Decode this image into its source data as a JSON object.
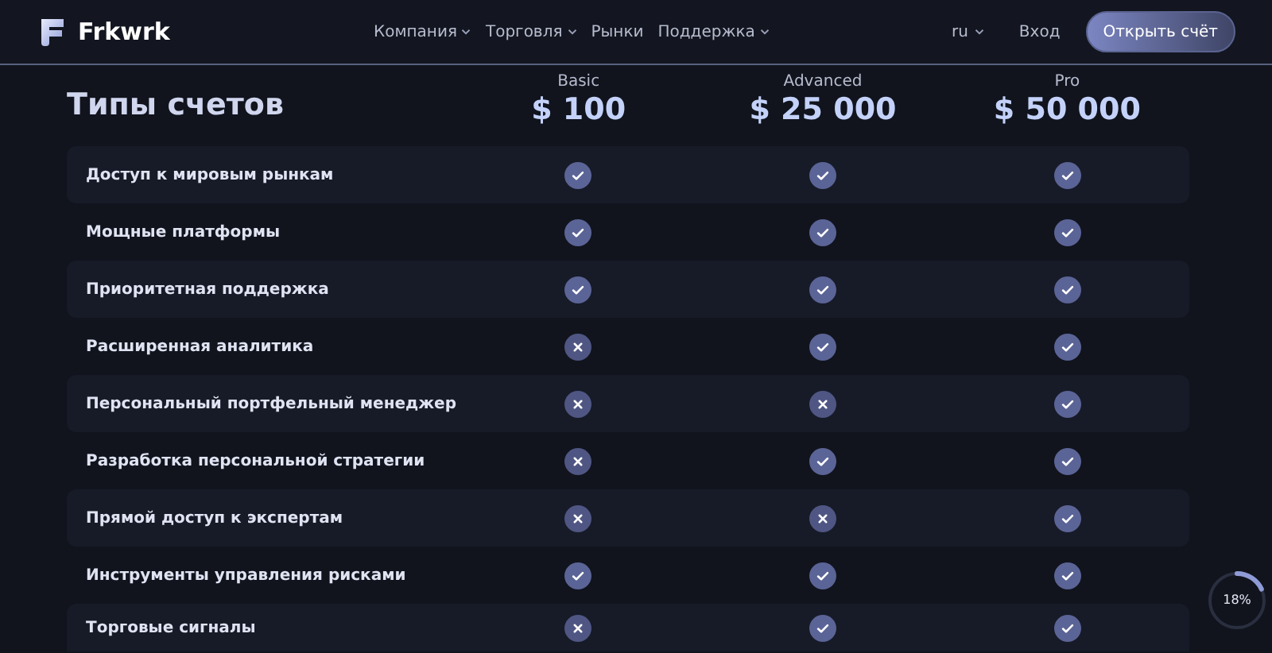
{
  "header": {
    "logo": "Frkwrk",
    "nav": [
      {
        "label": "Компания",
        "dropdown": true
      },
      {
        "label": "Торговля",
        "dropdown": true
      },
      {
        "label": "Рынки",
        "dropdown": false
      },
      {
        "label": "Поддержка",
        "dropdown": true
      }
    ],
    "language": "ru",
    "login": "Вход",
    "cta": "Открыть счёт"
  },
  "title": "Типы счетов",
  "plans": [
    {
      "name": "Basic",
      "price": "$ 100"
    },
    {
      "name": "Advanced",
      "price": "$ 25 000"
    },
    {
      "name": "Pro",
      "price": "$ 50 000"
    }
  ],
  "features": [
    {
      "label": "Доступ к мировым рынкам",
      "included": [
        true,
        true,
        true
      ]
    },
    {
      "label": "Мощные платформы",
      "included": [
        true,
        true,
        true
      ]
    },
    {
      "label": "Приоритетная поддержка",
      "included": [
        true,
        true,
        true
      ]
    },
    {
      "label": "Расширенная аналитика",
      "included": [
        false,
        true,
        true
      ]
    },
    {
      "label": "Персональный портфельный менеджер",
      "included": [
        false,
        false,
        true
      ]
    },
    {
      "label": "Разработка персональной стратегии",
      "included": [
        false,
        true,
        true
      ]
    },
    {
      "label": "Прямой доступ к экспертам",
      "included": [
        false,
        false,
        true
      ]
    },
    {
      "label": "Инструменты управления рисками",
      "included": [
        true,
        true,
        true
      ]
    },
    {
      "label": "Торговые сигналы",
      "included": [
        false,
        true,
        true
      ]
    }
  ],
  "scroll_progress": {
    "level": 0.18,
    "reading": "18%"
  }
}
